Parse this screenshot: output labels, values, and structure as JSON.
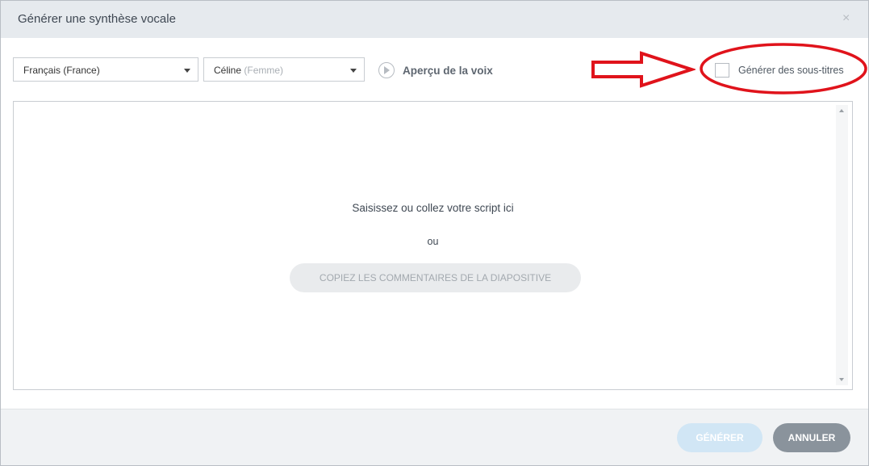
{
  "dialog": {
    "title": "Générer une synthèse vocale",
    "close_symbol": "×"
  },
  "language_select": {
    "value": "Français (France)"
  },
  "voice_select": {
    "value": "Céline",
    "sub": "(Femme)"
  },
  "preview": {
    "label": "Aperçu de la voix",
    "icon": "play-circle-icon"
  },
  "subtitles": {
    "label": "Générer des sous-titres",
    "checked": false
  },
  "annotation": {
    "color": "#e0131b"
  },
  "script_area": {
    "placeholder": "Saisissez ou collez votre script ici",
    "or_text": "ou",
    "copy_button": "COPIEZ LES COMMENTAIRES DE LA DIAPOSITIVE"
  },
  "footer": {
    "generate_label": "GÉNÉRER",
    "cancel_label": "ANNULER"
  },
  "colors": {
    "titlebar": "#e6eaee",
    "generate_button": "#d1e6f5",
    "cancel_button": "#8a939c"
  }
}
